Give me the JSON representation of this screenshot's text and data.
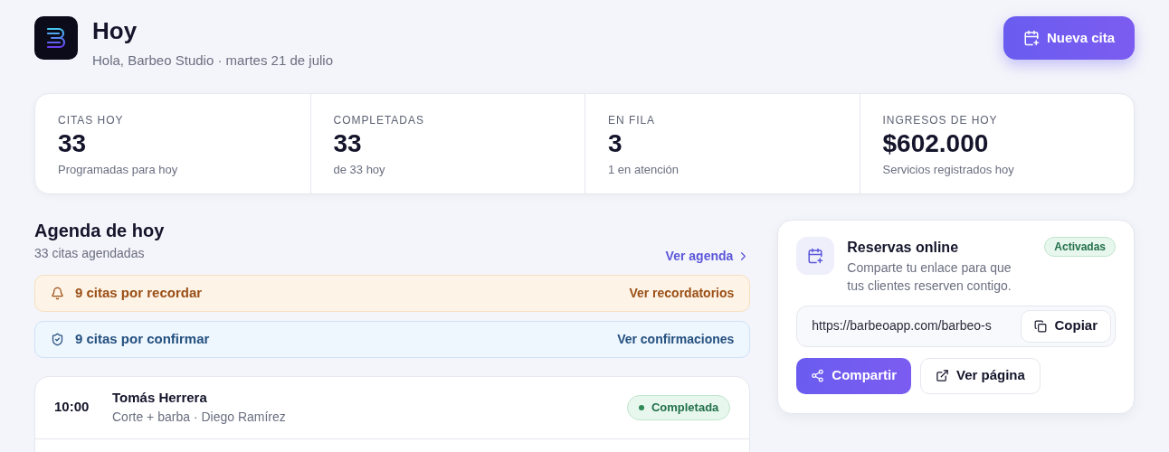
{
  "header": {
    "title": "Hoy",
    "subtitle": "Hola, Barbeo Studio · martes 21 de julio",
    "new_button": "Nueva cita"
  },
  "stats": [
    {
      "label": "CITAS HOY",
      "value": "33",
      "note": "Programadas para hoy"
    },
    {
      "label": "COMPLETADAS",
      "value": "33",
      "note": "de 33 hoy"
    },
    {
      "label": "EN FILA",
      "value": "3",
      "note": "1 en atención"
    },
    {
      "label": "INGRESOS DE HOY",
      "value": "$602.000",
      "note": "Servicios registrados hoy"
    }
  ],
  "agenda": {
    "title": "Agenda de hoy",
    "count": "33 citas agendadas",
    "link": "Ver agenda",
    "alerts": [
      {
        "kind": "reminder",
        "text": "9 citas por recordar",
        "action": "Ver recordatorios"
      },
      {
        "kind": "confirm",
        "text": "9 citas por confirmar",
        "action": "Ver confirmaciones"
      }
    ],
    "appointments": [
      {
        "time": "10:00",
        "client": "Tomás Herrera",
        "detail": "Corte + barba · Diego Ramírez",
        "status": "Completada",
        "kind": "completed"
      }
    ]
  },
  "booking": {
    "title": "Reservas online",
    "badge": "Activadas",
    "description": "Comparte tu enlace para que tus clientes reserven contigo.",
    "url": "https://barbeoapp.com/barbeo-s",
    "copy": "Copiar",
    "share": "Compartir",
    "view": "Ver página"
  }
}
